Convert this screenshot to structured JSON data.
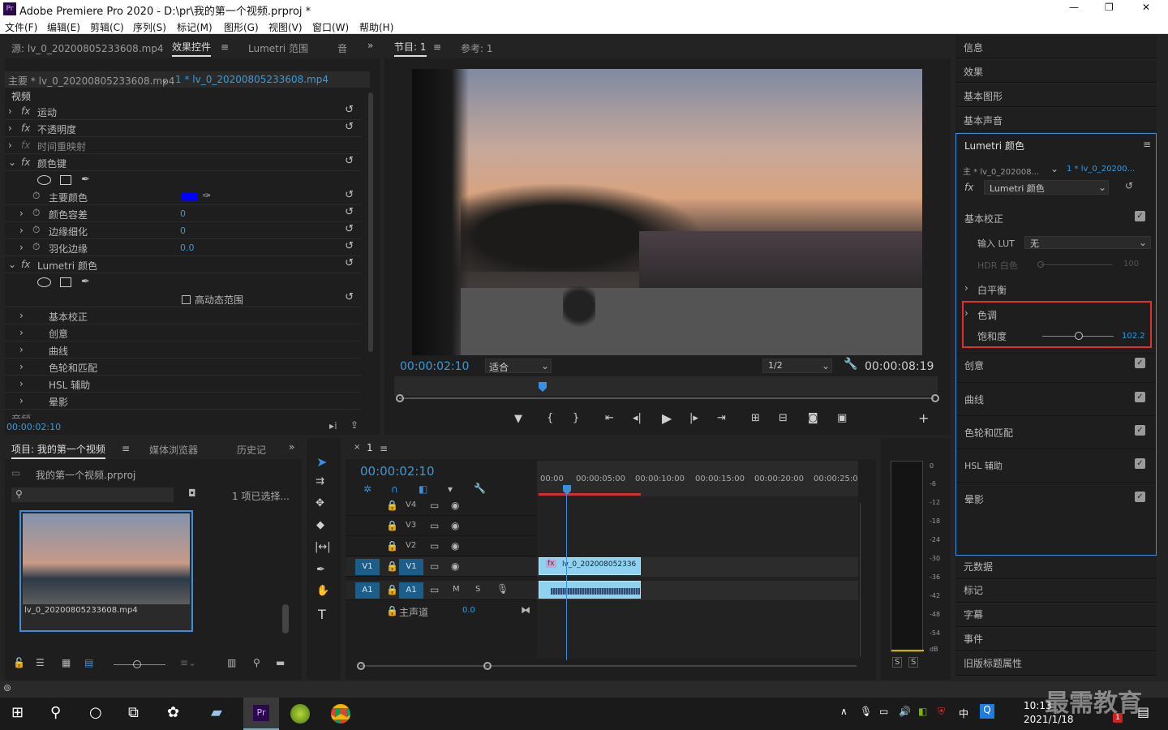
{
  "app": {
    "title": "Adobe Premiere Pro 2020 - D:\\pr\\我的第一个视频.prproj *",
    "min": "—",
    "max": "❐",
    "close": "✕",
    "logo": "Pr"
  },
  "menu": [
    "文件(F)",
    "编辑(E)",
    "剪辑(C)",
    "序列(S)",
    "标记(M)",
    "图形(G)",
    "视图(V)",
    "窗口(W)",
    "帮助(H)"
  ],
  "source_panel": {
    "tabs": [
      "源: lv_0_20200805233608.mp4",
      "效果控件",
      "Lumetri 范围",
      "音"
    ],
    "master": "主要 * lv_0_20200805233608.mp4",
    "clip": "1 * lv_0_20200805233608.mp4",
    "section_video": "视频",
    "timecode": "00:00:02:10",
    "section_audio": "音频"
  },
  "effects": [
    {
      "label": "运动",
      "fx": "fx"
    },
    {
      "label": "不透明度",
      "fx": "fx"
    },
    {
      "label": "时间重映射",
      "fx": "fx"
    },
    {
      "label": "颜色键",
      "fx": "fx"
    }
  ],
  "colorkey": {
    "main_color": "主要颜色",
    "tolerance": "颜色容差",
    "tolerance_val": "0",
    "thin": "边缘细化",
    "thin_val": "0",
    "feather": "羽化边缘",
    "feather_val": "0.0",
    "main_color_hex": "#0000ff"
  },
  "lumetri_fx": {
    "label": "Lumetri 颜色",
    "hdr": "高动态范围",
    "subs": [
      "基本校正",
      "创意",
      "曲线",
      "色轮和匹配",
      "HSL 辅助",
      "晕影"
    ]
  },
  "program": {
    "tab": "节目: 1",
    "ref": "参考: 1",
    "timecode": "00:00:02:10",
    "fit": "适合",
    "res": "1/2",
    "duration": "00:00:08:19"
  },
  "project": {
    "tabs": [
      "项目: 我的第一个视频",
      "媒体浏览器",
      "历史记",
      "»"
    ],
    "file": "我的第一个视频.prproj",
    "selected": "1 项已选择...",
    "clip": "lv_0_20200805233608.mp4"
  },
  "timeline": {
    "tab": "1",
    "timecode": "00:00:02:10",
    "ruler": [
      "00:00",
      "00:00:05:00",
      "00:00:10:00",
      "00:00:15:00",
      "00:00:20:00",
      "00:00:25:0"
    ],
    "tracks": [
      "V4",
      "V3",
      "V2",
      "V1",
      "A1"
    ],
    "master": "主声道",
    "master_val": "0.0",
    "clip": "lv_0_202008052336",
    "patch_v": "V1",
    "patch_a": "A1",
    "mute": "M",
    "solo": "S"
  },
  "meter": {
    "scale": [
      "0",
      "-6",
      "-12",
      "-18",
      "-24",
      "-30",
      "-36",
      "-42",
      "-48",
      "-54",
      "dB"
    ],
    "s": "S"
  },
  "right_panel": {
    "top": [
      "信息",
      "效果",
      "基本图形",
      "基本声音"
    ],
    "lumetri_title": "Lumetri 颜色",
    "master": "主 * lv_0_202008...",
    "clip": "1 * lv_0_20200...",
    "fx": "Lumetri 颜色",
    "basic": "基本校正",
    "lut_label": "输入 LUT",
    "lut_val": "无",
    "hdr_white": "HDR 白色",
    "hdr_val": "100",
    "wb": "白平衡",
    "tone": "色调",
    "sat_label": "饱和度",
    "sat_val": "102.2",
    "sections": [
      "创意",
      "曲线",
      "色轮和匹配",
      "HSL 辅助",
      "晕影"
    ],
    "bottom": [
      "元数据",
      "标记",
      "字幕",
      "事件",
      "旧版标题属性"
    ]
  },
  "taskbar": {
    "time": "10:13",
    "date": "2021/1/18",
    "ime": "中",
    "watermark": "最需教育",
    "notif": "1"
  }
}
